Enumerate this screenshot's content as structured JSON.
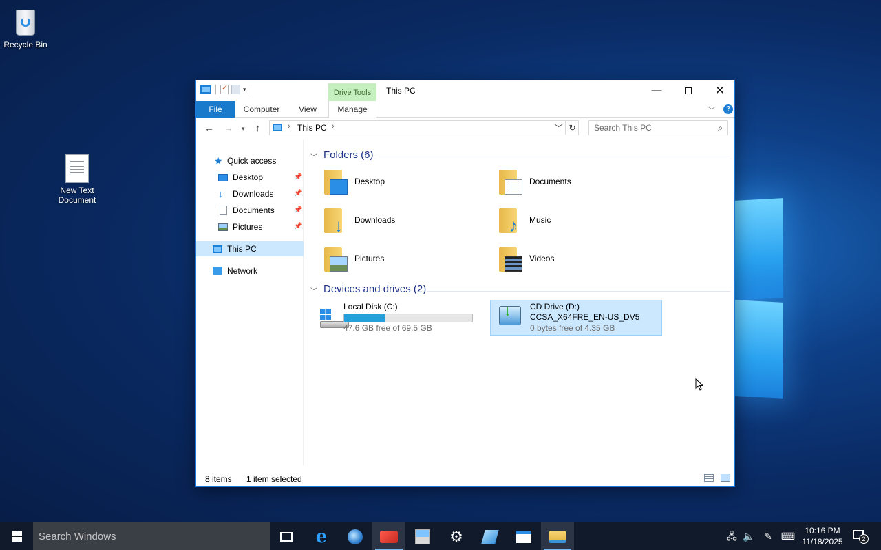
{
  "desktop": {
    "icons": [
      {
        "label": "Recycle Bin",
        "icon": "recycle-bin-icon"
      },
      {
        "label": "New Text\nDocument",
        "icon": "text-document-icon"
      }
    ]
  },
  "window": {
    "title": "This PC",
    "contextual_tab_group": "Drive Tools",
    "ribbon_tabs": [
      "File",
      "Computer",
      "View",
      "Manage"
    ],
    "controls": {
      "minimize": "—",
      "maximize": "",
      "close": "✕"
    },
    "help": "?"
  },
  "navbar": {
    "breadcrumb": [
      "This PC"
    ],
    "search_placeholder": "Search This PC"
  },
  "sidebar": {
    "items": [
      {
        "label": "Quick access",
        "icon": "star-icon"
      },
      {
        "label": "Desktop",
        "icon": "desktop-icon",
        "pinned": true
      },
      {
        "label": "Downloads",
        "icon": "download-icon",
        "pinned": true
      },
      {
        "label": "Documents",
        "icon": "documents-icon",
        "pinned": true
      },
      {
        "label": "Pictures",
        "icon": "pictures-icon",
        "pinned": true
      },
      {
        "label": "This PC",
        "icon": "computer-icon",
        "selected": true
      },
      {
        "label": "Network",
        "icon": "network-icon"
      }
    ]
  },
  "content": {
    "folders_header": "Folders (6)",
    "folders": [
      {
        "label": "Desktop"
      },
      {
        "label": "Documents"
      },
      {
        "label": "Downloads"
      },
      {
        "label": "Music"
      },
      {
        "label": "Pictures"
      },
      {
        "label": "Videos"
      }
    ],
    "drives_header": "Devices and drives (2)",
    "drives": [
      {
        "name": "Local Disk (C:)",
        "free_text": "47.6 GB free of 69.5 GB",
        "used_fraction": 0.315
      },
      {
        "name": "CD Drive (D:)",
        "volume_label": "CCSA_X64FRE_EN-US_DV5",
        "free_text": "0 bytes free of 4.35 GB",
        "selected": true
      }
    ]
  },
  "status": {
    "item_count": "8 items",
    "selection": "1 item selected"
  },
  "taskbar": {
    "search_placeholder": "Search Windows",
    "apps": [
      "task-view-icon",
      "internet-explorer-icon",
      "globe-icon",
      "red-app-icon",
      "server-manager-icon",
      "settings-gear-icon",
      "pen-app-icon",
      "window-app-icon",
      "file-explorer-icon"
    ],
    "time": "10:16 PM",
    "date": "11/18/2025",
    "notification_count": "2"
  },
  "colors": {
    "accent": "#1979ca",
    "selection": "#cce8ff",
    "drive_tools_tab": "#c6efbf",
    "capacity_bar": "#26a0da",
    "taskbar": "#101a2a"
  }
}
